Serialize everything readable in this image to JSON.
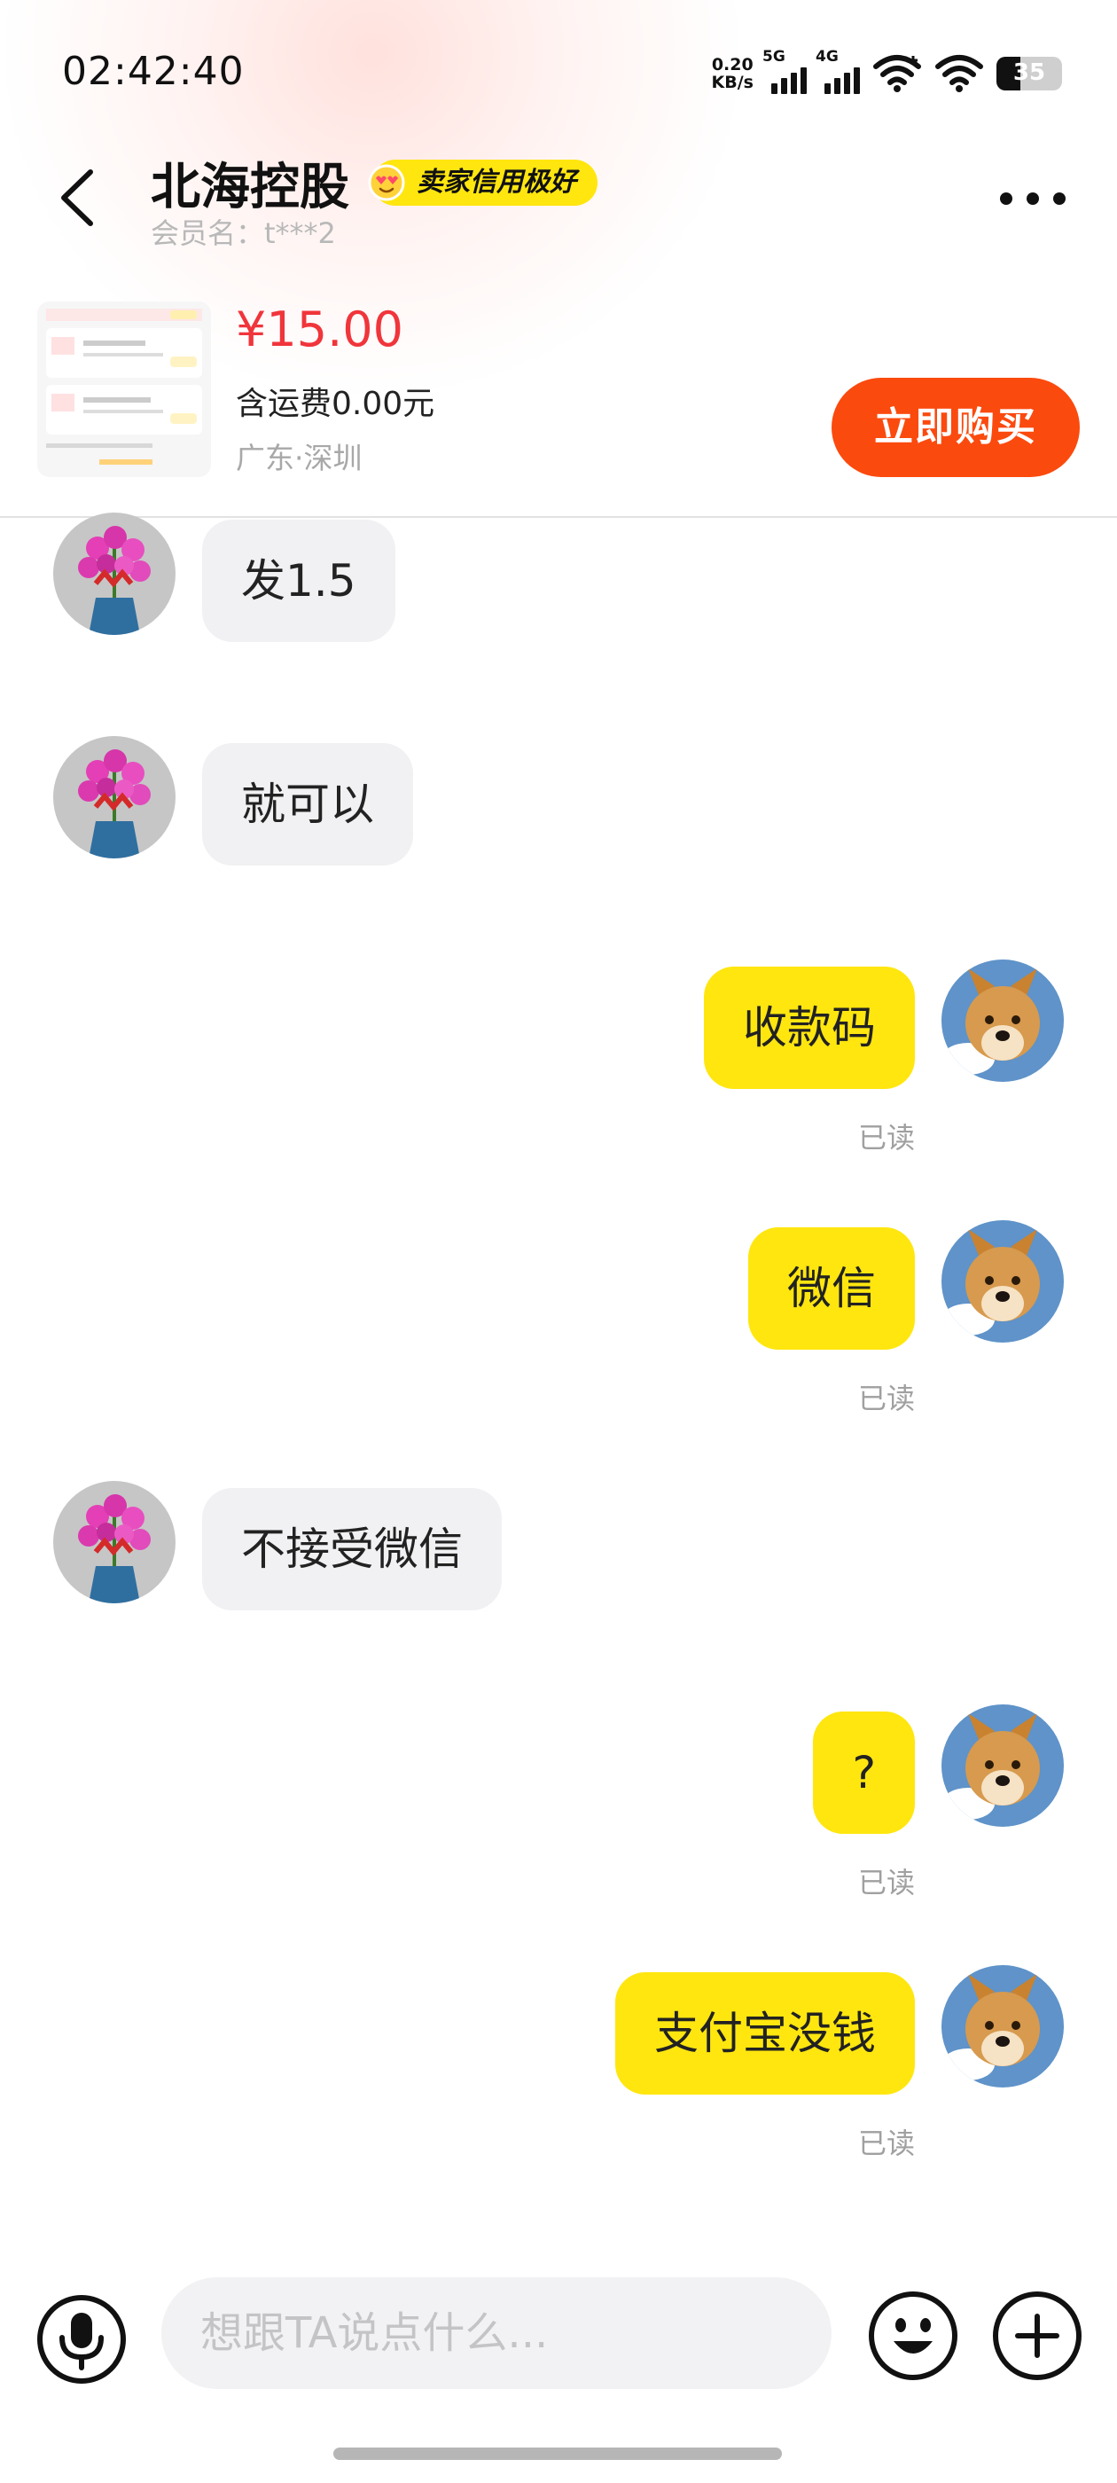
{
  "status_bar": {
    "time": "02:42:40",
    "net_speed_value": "0.20",
    "net_speed_unit": "KB/s",
    "signal_1_label": "5G",
    "signal_2_label": "4G",
    "battery_level": "35"
  },
  "header": {
    "seller_name": "北海控股",
    "credit_badge": "卖家信用极好",
    "member_name": "会员名：t***2"
  },
  "product": {
    "price": "¥15.00",
    "shipping": "含运费0.00元",
    "location": "广东·深圳",
    "buy_button": "立即购买"
  },
  "messages": [
    {
      "side": "left",
      "text": "发1.5"
    },
    {
      "side": "left",
      "text": "就可以"
    },
    {
      "side": "right",
      "text": "收款码",
      "status": "已读"
    },
    {
      "side": "right",
      "text": "微信",
      "status": "已读"
    },
    {
      "side": "left",
      "text": "不接受微信"
    },
    {
      "side": "right",
      "text": "?",
      "status": "已读"
    },
    {
      "side": "right",
      "text": "支付宝没钱",
      "status": "已读"
    }
  ],
  "input": {
    "placeholder": "想跟TA说点什么..."
  },
  "colors": {
    "accent_yellow": "#ffe60f",
    "buy_orange": "#fb4a0e",
    "price_red": "#f0353b"
  },
  "icons": [
    "back-arrow-icon",
    "more-icon",
    "mic-icon",
    "emoji-icon",
    "plus-icon",
    "wifi-icon",
    "battery-icon"
  ]
}
